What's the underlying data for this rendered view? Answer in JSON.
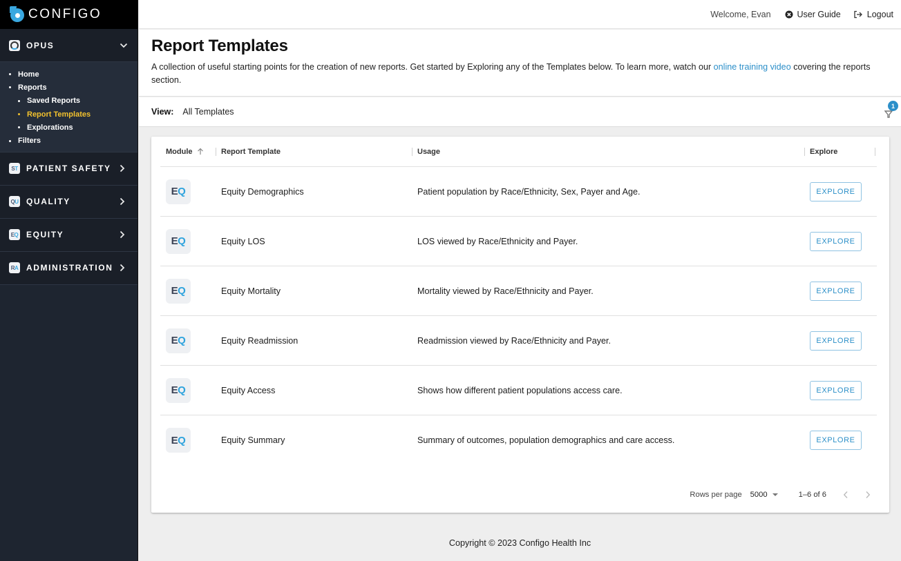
{
  "brand": {
    "name": "CONFIGO"
  },
  "sidebar": {
    "sections": [
      {
        "id": "opus",
        "label": "OPUS",
        "icon": "opus-ring-icon",
        "expanded": true
      },
      {
        "id": "patient-safety",
        "label": "PATIENT SAFETY",
        "icon_text_a": "S",
        "icon_text_b": "T",
        "expanded": false
      },
      {
        "id": "quality",
        "label": "QUALITY",
        "icon_text_a": "Q",
        "icon_text_b": "U",
        "expanded": false
      },
      {
        "id": "equity",
        "label": "EQUITY",
        "icon_text_a": "E",
        "icon_text_b": "Q",
        "expanded": false
      },
      {
        "id": "administration",
        "label": "ADMINISTRATION",
        "icon_text_a": "R",
        "icon_text_b": "A",
        "expanded": false
      }
    ],
    "opus_items": [
      {
        "label": "Home",
        "level": 1,
        "active": false
      },
      {
        "label": "Reports",
        "level": 1,
        "active": false
      },
      {
        "label": "Saved Reports",
        "level": 2,
        "active": false
      },
      {
        "label": "Report Templates",
        "level": 2,
        "active": true
      },
      {
        "label": "Explorations",
        "level": 2,
        "active": false
      },
      {
        "label": "Filters",
        "level": 1,
        "active": false
      }
    ]
  },
  "topbar": {
    "welcome": "Welcome, Evan",
    "user_guide": "User Guide",
    "logout": "Logout"
  },
  "page": {
    "title": "Report Templates",
    "description_before": "A collection of useful starting points for the creation of new reports. Get started by Exploring any of the Templates below. To learn more, watch our ",
    "description_link": "online training video",
    "description_after": " covering the reports section."
  },
  "view": {
    "label": "View:",
    "value": "All Templates",
    "filter_count": "1"
  },
  "table": {
    "columns": [
      "Module",
      "Report Template",
      "Usage",
      "Explore"
    ],
    "sort": {
      "column": "Module",
      "direction": "asc"
    },
    "rows": [
      {
        "module_a": "E",
        "module_b": "Q",
        "template": "Equity Demographics",
        "usage": "Patient population by Race/Ethnicity, Sex, Payer and Age.",
        "action": "EXPLORE"
      },
      {
        "module_a": "E",
        "module_b": "Q",
        "template": "Equity LOS",
        "usage": "LOS viewed by Race/Ethnicity and Payer.",
        "action": "EXPLORE"
      },
      {
        "module_a": "E",
        "module_b": "Q",
        "template": "Equity Mortality",
        "usage": "Mortality viewed by Race/Ethnicity and Payer.",
        "action": "EXPLORE"
      },
      {
        "module_a": "E",
        "module_b": "Q",
        "template": "Equity Readmission",
        "usage": "Readmission viewed by Race/Ethnicity and Payer.",
        "action": "EXPLORE"
      },
      {
        "module_a": "E",
        "module_b": "Q",
        "template": "Equity Access",
        "usage": "Shows how different patient populations access care.",
        "action": "EXPLORE"
      },
      {
        "module_a": "E",
        "module_b": "Q",
        "template": "Equity Summary",
        "usage": "Summary of outcomes, population demographics and care access.",
        "action": "EXPLORE"
      }
    ]
  },
  "pagination": {
    "rows_per_page_label": "Rows per page",
    "rows_per_page": "5000",
    "range": "1–6 of 6"
  },
  "footer": {
    "copyright": "Copyright © 2023 Configo Health Inc"
  },
  "colors": {
    "accent": "#2c8fc9",
    "active_nav": "#f2c12e",
    "sidebar_bg": "#1e2530"
  }
}
